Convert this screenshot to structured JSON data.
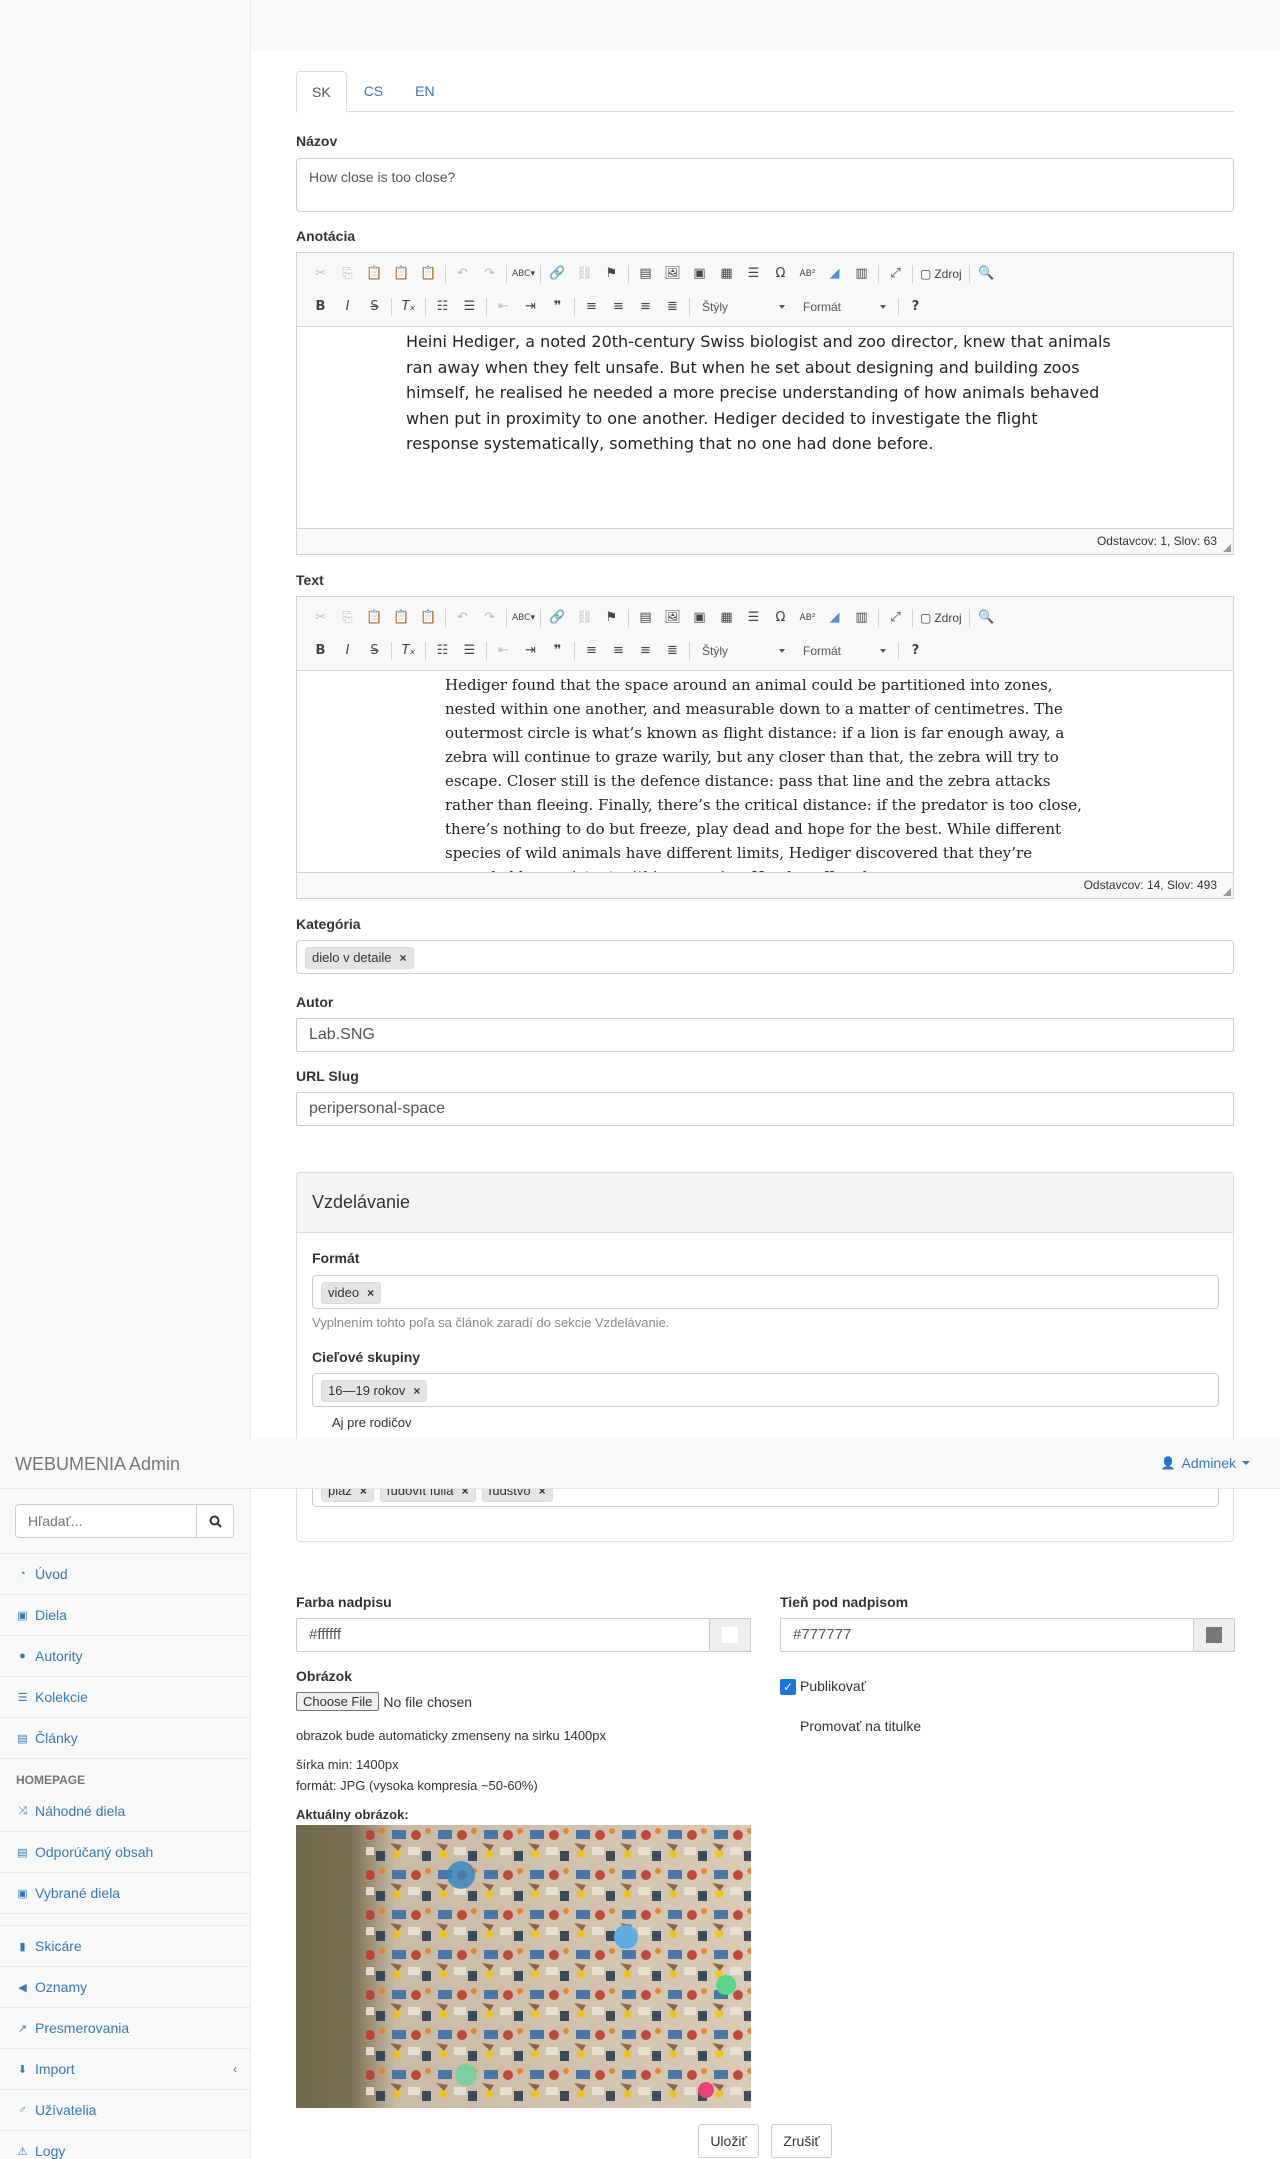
{
  "navbar": {
    "brand": "WEBUMENIA Admin",
    "user": "Adminek"
  },
  "sidebar": {
    "search_placeholder": "Hľadať...",
    "items": [
      {
        "label": "Úvod",
        "icon": "dashboard-icon"
      },
      {
        "label": "Diela",
        "icon": "image-icon"
      },
      {
        "label": "Autority",
        "icon": "user-icon"
      },
      {
        "label": "Kolekcie",
        "icon": "list-icon"
      },
      {
        "label": "Články",
        "icon": "newspaper-icon"
      }
    ],
    "homepage_heading": "HOMEPAGE",
    "homepage_items": [
      {
        "label": "Náhodné diela",
        "icon": "random-icon"
      },
      {
        "label": "Odporúčaný obsah",
        "icon": "newspaper-icon"
      },
      {
        "label": "Vybrané diela",
        "icon": "image-icon"
      }
    ],
    "more_items": [
      {
        "label": "Skicáre",
        "icon": "book-icon"
      },
      {
        "label": "Oznamy",
        "icon": "bullhorn-icon"
      },
      {
        "label": "Presmerovania",
        "icon": "external-link-icon"
      },
      {
        "label": "Import",
        "icon": "download-icon"
      },
      {
        "label": "Užívatelia",
        "icon": "male-icon"
      },
      {
        "label": "Logy",
        "icon": "warning-icon"
      }
    ]
  },
  "tabs": [
    "SK",
    "CS",
    "EN"
  ],
  "form": {
    "nazov_label": "Názov",
    "nazov_value": "How close is too close?",
    "anotacia_label": "Anotácia",
    "anotacia_text": "Heini Hediger, a noted 20th-century Swiss biologist and zoo director, knew that animals ran away when they felt unsafe. But when he set about designing and building zoos himself, he realised he needed a more precise understanding of how animals behaved when put in proximity to one another. Hediger decided to investigate the flight response systematically, something that no one had done before.",
    "anotacia_status": "Odstavcov: 1, Slov: 63",
    "text_label": "Text",
    "text_body": "Hediger found that the space around an animal could be partitioned into zones, nested within one another, and measurable down to a matter of centimetres. The outermost circle is what’s known as flight distance: if a lion is far enough away, a zebra will continue to graze warily, but any closer than that, the zebra will try to escape. Closer still is the defence distance: pass that line and the zebra attacks rather than fleeing. Finally, there’s the critical distance: if the predator is too close, there’s nothing to do but freeze, play dead and hope for the best. While different species of wild animals have different limits, Hediger discovered that they’re remarkably consistent within a species. He also offered a",
    "text_status": "Odstavcov: 14, Slov: 493",
    "toolbar": {
      "zdroj": "Zdroj",
      "styly": "Štýly",
      "format": "Formát"
    },
    "kategoria_label": "Kategória",
    "kategoria_chip": "dielo v detaile",
    "autor_label": "Autor",
    "autor_value": "Lab.SNG",
    "slug_label": "URL Slug",
    "slug_value": "peripersonal-space"
  },
  "panel": {
    "title": "Vzdelávanie",
    "format_label": "Formát",
    "format_chip": "video",
    "format_help": "Vyplnením tohto poľa sa článok zaradí do sekcie Vzdelávanie.",
    "skupiny_label": "Cieľové skupiny",
    "skupiny_chip": "16—19 rokov",
    "rodicov": "Aj pre rodičov",
    "tags": [
      "pláž",
      "ľudovít fulla",
      "ľudstvo"
    ]
  },
  "bottom": {
    "farba_label": "Farba nadpisu",
    "farba_value": "#ffffff",
    "farba_color": "#ffffff",
    "tien_label": "Tieň pod nadpisom",
    "tien_value": "#777777",
    "tien_color": "#777777",
    "obrazok_label": "Obrázok",
    "choose_file": "Choose File",
    "no_file": "No file chosen",
    "resize_note": "obrazok bude automaticky zmenseny na sirku 1400px",
    "min_width": "šírka min: 1400px",
    "format_note": "formát: JPG (vysoka kompresia ~50-60%)",
    "aktualny_label": "Aktuálny obrázok:",
    "publikovat": "Publikovať",
    "promovat": "Promovať na titulke",
    "save": "Uložiť",
    "cancel": "Zrušiť"
  },
  "colors": {
    "link": "#337ab7",
    "accent_check": "#1a73e8"
  }
}
